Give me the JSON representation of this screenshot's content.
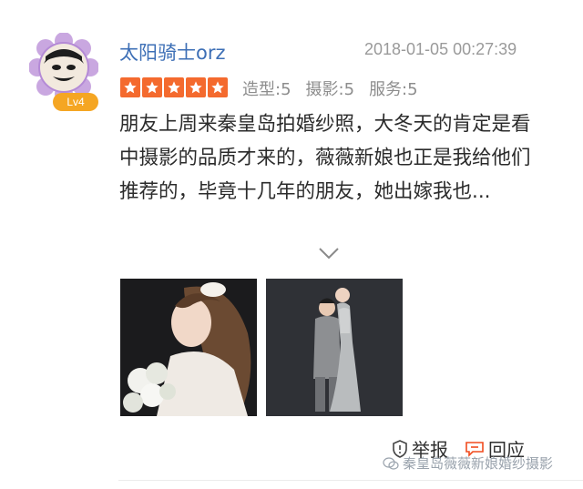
{
  "review": {
    "username": "太阳骑士orz",
    "timestamp": "2018-01-05 00:27:39",
    "level": "Lv4",
    "star_rating": 5,
    "star_max": 5,
    "ratings": [
      {
        "label": "造型:5"
      },
      {
        "label": "摄影:5"
      },
      {
        "label": "服务:5"
      }
    ],
    "text": "朋友上周来秦皇岛拍婚纱照，大冬天的肯定是看中摄影的品质才来的，薇薇新娘也正是我给他们推荐的，毕竟十几年的朋友，她出嫁我也...",
    "expand_icon": "chevron-down-icon",
    "photos": [
      {
        "icon": "photo-bride-portrait"
      },
      {
        "icon": "photo-couple-portrait"
      }
    ]
  },
  "actions": {
    "report_label": "举报",
    "reply_label": "回应"
  },
  "watermark": {
    "text": "秦皇岛薇薇新娘婚纱摄影"
  },
  "colors": {
    "username": "#3d6fb6",
    "star": "#f46a2e",
    "badge": "#f5a623",
    "reply_icon": "#f04b1e"
  }
}
